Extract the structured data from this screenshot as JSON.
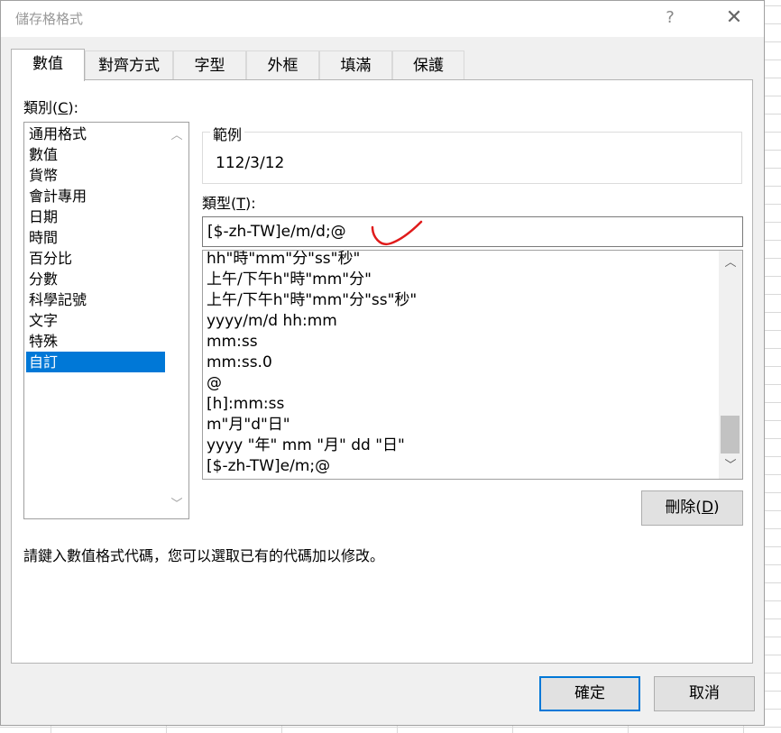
{
  "window": {
    "title": "儲存格格式",
    "help": "?",
    "close": "✕"
  },
  "tabs": [
    "數值",
    "對齊方式",
    "字型",
    "外框",
    "填滿",
    "保護"
  ],
  "category": {
    "label_prefix": "類別(",
    "label_key": "C",
    "label_suffix": "):",
    "items": [
      "通用格式",
      "數值",
      "貨幣",
      "會計專用",
      "日期",
      "時間",
      "百分比",
      "分數",
      "科學記號",
      "文字",
      "特殊",
      "自訂"
    ],
    "selected_index": 11
  },
  "sample": {
    "label": "範例",
    "value": "112/3/12"
  },
  "type": {
    "label_prefix": "類型(",
    "label_key": "T",
    "label_suffix": "):",
    "input_value": "[$-zh-TW]e/m/d;@",
    "list": [
      "hh\"時\"mm\"分\"ss\"秒\"",
      "上午/下午h\"時\"mm\"分\"",
      "上午/下午h\"時\"mm\"分\"ss\"秒\"",
      "yyyy/m/d hh:mm",
      "mm:ss",
      "mm:ss.0",
      "@",
      "[h]:mm:ss",
      "m\"月\"d\"日\"",
      "yyyy \"年\" mm \"月\" dd \"日\"",
      "[$-zh-TW]e/m;@"
    ]
  },
  "delete_button": {
    "prefix": "刪除(",
    "key": "D",
    "suffix": ")"
  },
  "hint": "請鍵入數值格式代碼，您可以選取已有的代碼加以修改。",
  "ok_label": "確定",
  "cancel_label": "取消",
  "colors": {
    "selection": "#0078d7",
    "annotation": "#e01b1b"
  },
  "icons": {
    "scroll_up": "chevron-up-icon",
    "scroll_down": "chevron-down-icon",
    "annotation": "checkmark-annotation"
  }
}
